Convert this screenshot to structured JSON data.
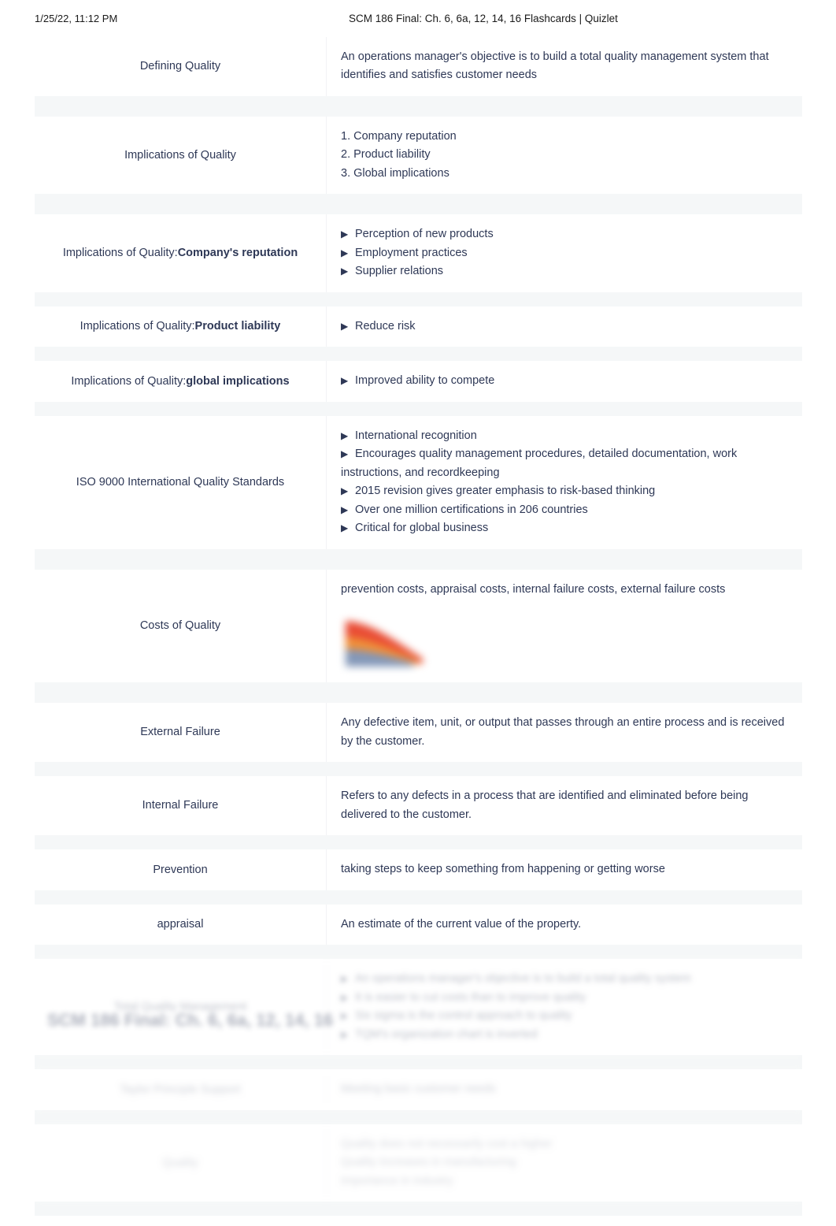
{
  "print_header": {
    "date": "1/25/22, 11:12 PM",
    "title": "SCM 186 Final: Ch. 6, 6a, 12, 14, 16 Flashcards | Quizlet"
  },
  "footer": {
    "title": "SCM 186 Final: Ch. 6, 6a, 12, 14, 16"
  },
  "colors": {
    "text": "#2e3856",
    "row_gap": "#f5f7f8",
    "divider": "#f2f3f5",
    "thumb_red": "#e8432a",
    "thumb_orange": "#f08a2e",
    "thumb_blue": "#7e93b5"
  },
  "cards": [
    {
      "term": "Defining Quality",
      "term_bold": "",
      "definition_lines": [
        "An operations manager's objective is to build a total quality management system that identifies and satisfies customer needs"
      ],
      "bulleted": false
    },
    {
      "term": "Implications of Quality",
      "term_bold": "",
      "definition_lines": [
        "1. Company reputation",
        "2. Product liability",
        "3. Global implications"
      ],
      "bulleted": false
    },
    {
      "term": "Implications of Quality: ",
      "term_bold": "Company's reputation",
      "definition_lines": [
        "Perception of new products",
        "Employment practices",
        "Supplier relations"
      ],
      "bulleted": true
    },
    {
      "term": "Implications of Quality: ",
      "term_bold": "Product liability",
      "definition_lines": [
        "Reduce risk"
      ],
      "bulleted": true
    },
    {
      "term": "Implications of Quality: ",
      "term_bold": "global implications",
      "definition_lines": [
        "Improved ability to compete"
      ],
      "bulleted": true
    },
    {
      "term": "ISO 9000 International Quality Standards",
      "term_bold": "",
      "definition_lines": [
        "International recognition",
        "Encourages quality management procedures, detailed documentation, work instructions, and recordkeeping",
        "2015 revision gives greater emphasis to risk-based thinking",
        "Over one million certifications in 206 countries",
        "Critical for global business"
      ],
      "bulleted": true
    },
    {
      "term": "Costs of Quality",
      "term_bold": "",
      "definition_lines": [
        "prevention costs, appraisal costs, internal failure costs, external failure costs"
      ],
      "bulleted": false,
      "has_image": true
    },
    {
      "term": "External Failure",
      "term_bold": "",
      "definition_lines": [
        "Any defective item, unit, or output that passes through an entire process and is received by the customer."
      ],
      "bulleted": false
    },
    {
      "term": "Internal Failure",
      "term_bold": "",
      "definition_lines": [
        "Refers to any defects in a process that are identified and eliminated before being delivered to the customer."
      ],
      "bulleted": false
    },
    {
      "term": "Prevention",
      "term_bold": "",
      "definition_lines": [
        "taking steps to keep something from happening or getting worse"
      ],
      "bulleted": false
    },
    {
      "term": "appraisal",
      "term_bold": "",
      "definition_lines": [
        "An estimate of the current value of the property."
      ],
      "bulleted": false
    }
  ],
  "faded_cards": [
    {
      "term": "Total Quality Management",
      "term_bold": "",
      "definition_lines": [
        "An operations manager's objective is to build a total quality system",
        "It is easier to cut costs than to improve quality",
        "Six sigma is the control approach to quality",
        "TQM's organization chart is inverted"
      ],
      "bulleted": true,
      "fade": "faded-1"
    },
    {
      "term": "Taylor Principle Support",
      "term_bold": "",
      "definition_lines": [
        "Meeting basic customer needs"
      ],
      "bulleted": false,
      "fade": "faded-2"
    },
    {
      "term": "Quality",
      "term_bold": "",
      "definition_lines": [
        "Quality does not necessarily cost a higher",
        "Quality increases in manufacturing",
        "Importance in industry"
      ],
      "bulleted": false,
      "fade": "faded-3"
    }
  ]
}
